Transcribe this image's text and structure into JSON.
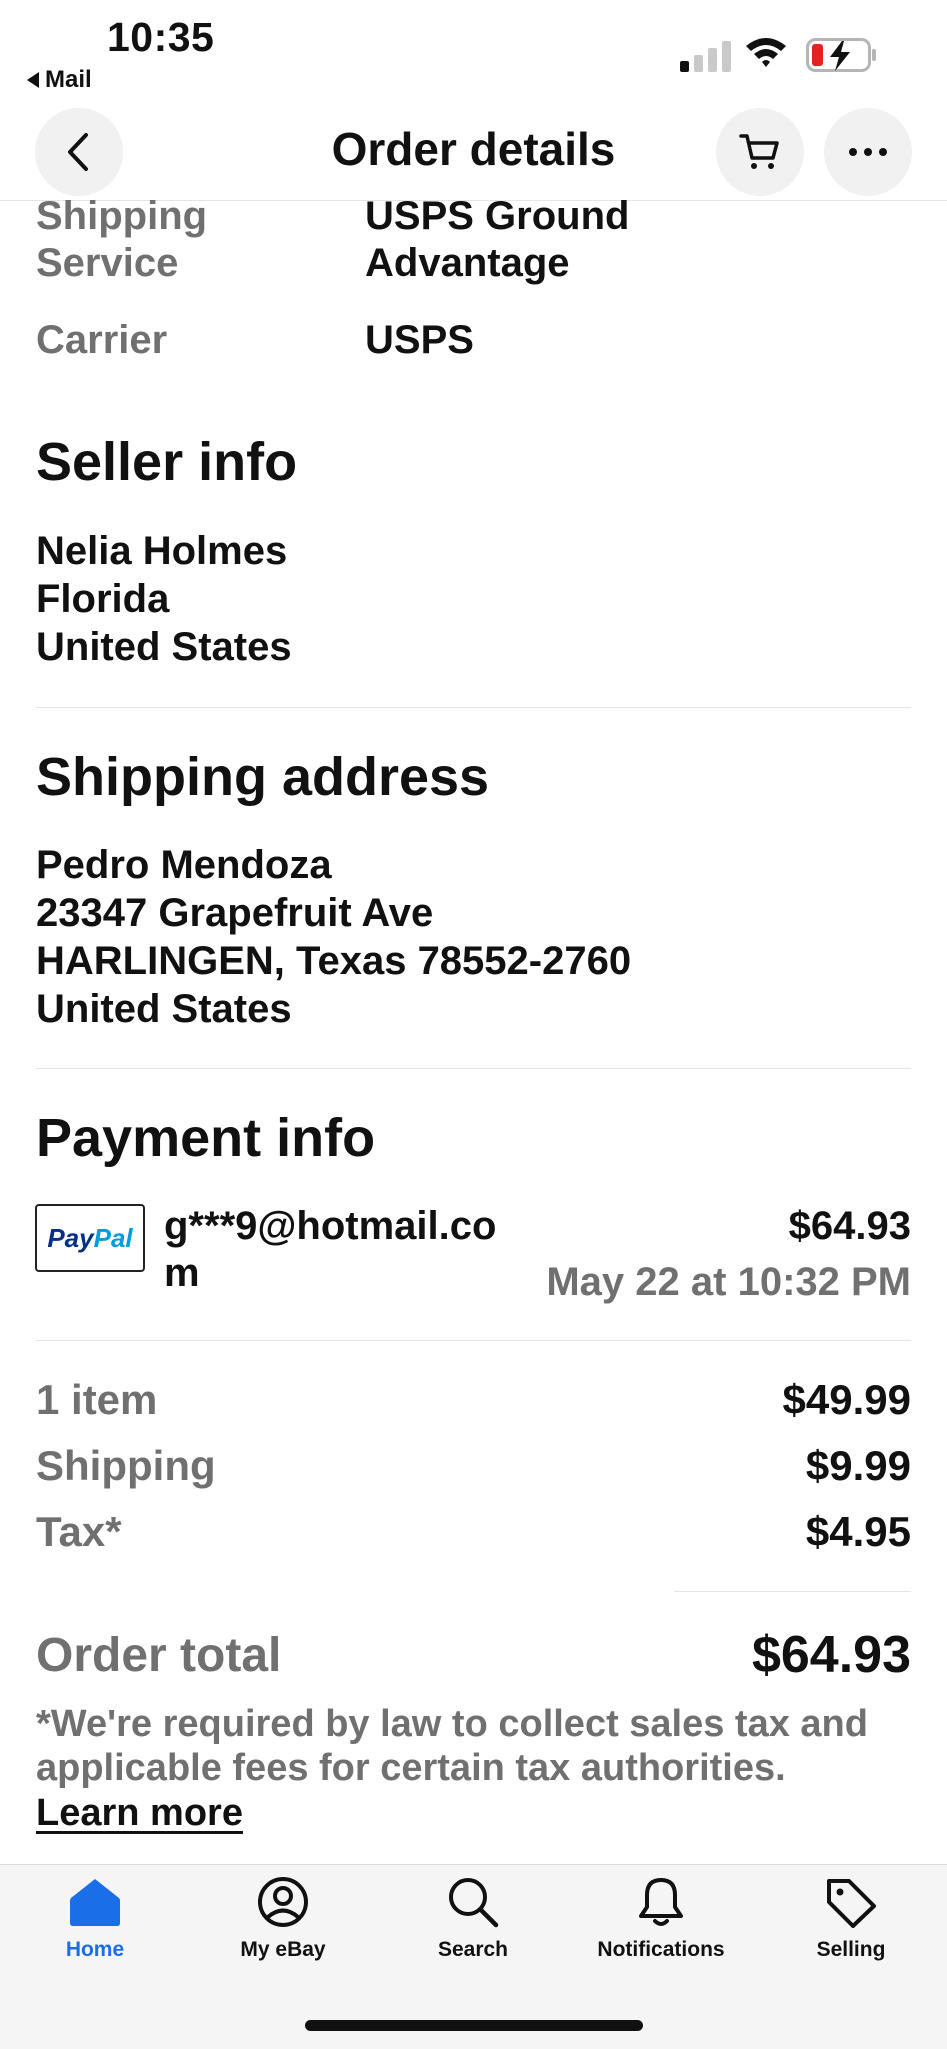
{
  "status_bar": {
    "time": "10:35",
    "back_app": "Mail"
  },
  "nav": {
    "title": "Order details"
  },
  "shipping": {
    "service_label": [
      "Shipping",
      "Service"
    ],
    "service_value": [
      "USPS Ground",
      "Advantage"
    ],
    "carrier_label": "Carrier",
    "carrier_value": "USPS"
  },
  "seller": {
    "title": "Seller info",
    "lines": [
      "Nelia Holmes",
      "Florida",
      "United States"
    ]
  },
  "address": {
    "title": "Shipping address",
    "lines": [
      "Pedro Mendoza",
      "23347 Grapefruit Ave",
      "HARLINGEN, Texas 78552-2760",
      "United States"
    ]
  },
  "payment": {
    "title": "Payment info",
    "method_logo": [
      "Pay",
      "Pal"
    ],
    "email_lines": [
      "g***9@hotmail.co",
      "m"
    ],
    "amount": "$64.93",
    "date": "May 22 at 10:32 PM"
  },
  "summary": {
    "items_label": "1 item",
    "items_value": "$49.99",
    "shipping_label": "Shipping",
    "shipping_value": "$9.99",
    "tax_label": "Tax*",
    "tax_value": "$4.95",
    "total_label": "Order total",
    "total_value": "$64.93",
    "note": "*We're required by law to collect sales tax and applicable fees for certain tax authorities.",
    "learn_more": "Learn more"
  },
  "tabs": [
    {
      "label": "Home",
      "icon": "home-icon",
      "active": true
    },
    {
      "label": "My eBay",
      "icon": "account-icon",
      "active": false
    },
    {
      "label": "Search",
      "icon": "search-icon",
      "active": false
    },
    {
      "label": "Notifications",
      "icon": "bell-icon",
      "active": false
    },
    {
      "label": "Selling",
      "icon": "tag-icon",
      "active": false
    }
  ],
  "colors": {
    "accent": "#1a6fe8",
    "muted_text": "#707070",
    "paypal_dark": "#003087",
    "paypal_light": "#009cde"
  }
}
